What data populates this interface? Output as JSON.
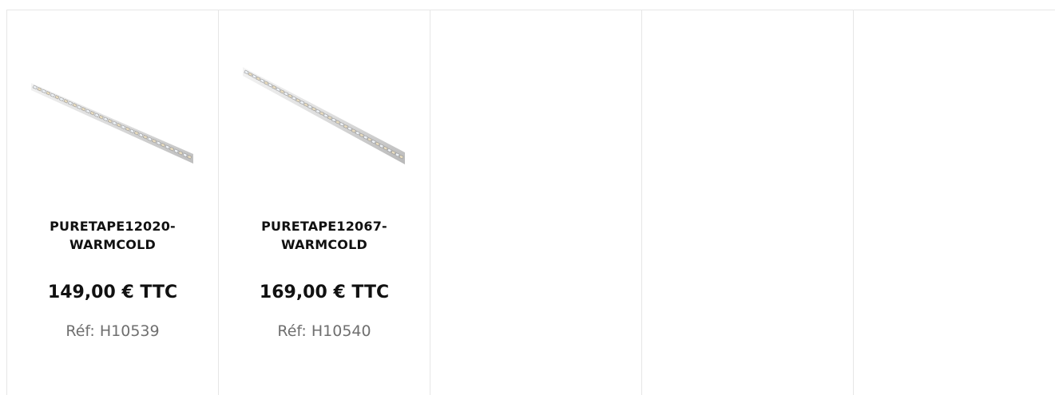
{
  "products": [
    {
      "name": "PURETAPE12020-WARMCOLD",
      "name_line1": "PURETAPE12020-",
      "name_line2": "WARMCOLD",
      "price": "149,00 € TTC",
      "ref_label": "Réf:",
      "ref_value": "H10539",
      "image_icon": "led-strip-image"
    },
    {
      "name": "PURETAPE12067-WARMCOLD",
      "name_line1": "PURETAPE12067-",
      "name_line2": "WARMCOLD",
      "price": "169,00 € TTC",
      "ref_label": "Réf:",
      "ref_value": "H10540",
      "image_icon": "led-strip-image"
    }
  ],
  "colors": {
    "border": "#e6e6e6",
    "text": "#111111",
    "muted": "#6f6f6f",
    "strip_base": "#d9d9d9",
    "led_warm": "#e8dcc0",
    "led_cold": "#eef2f6"
  }
}
